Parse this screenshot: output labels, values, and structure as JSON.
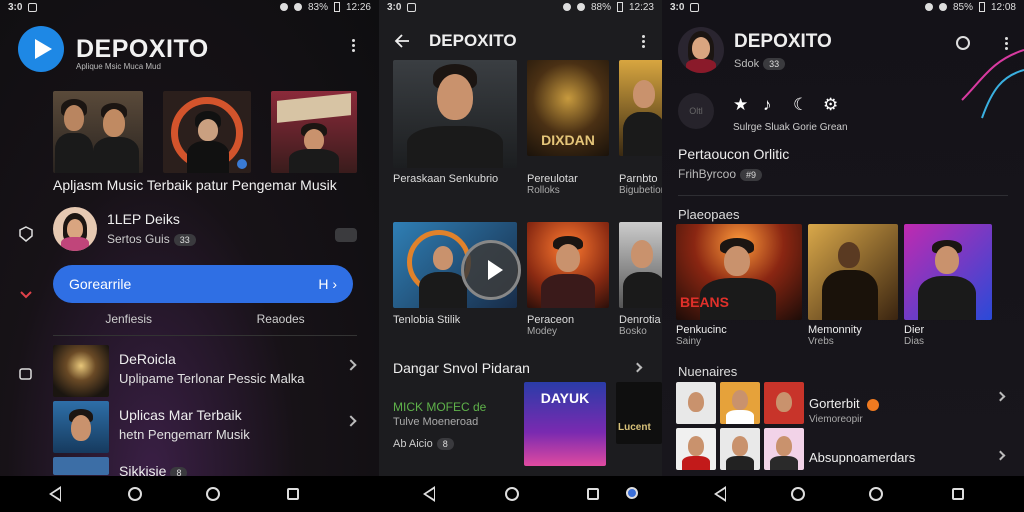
{
  "status_bars": [
    {
      "time": "3:0",
      "battery": "83%",
      "clock": "12:26"
    },
    {
      "time": "3:0",
      "battery": "88%",
      "clock": "12:23"
    },
    {
      "time": "3:0",
      "battery": "85%",
      "clock": "12:08"
    }
  ],
  "screen1": {
    "app_title": "DEPOXITO",
    "app_subtitle": "Aplique Msic Muca Mud",
    "caption": "Apljasm Music Terbaik patur Pengemar Musik",
    "profile": {
      "name": "1LEP Deiks",
      "meta": "Sertos Guis",
      "badge": "33"
    },
    "search_bar": {
      "label": "Gorearrile",
      "icon_text": "H ›"
    },
    "tabs": [
      "Jenfiesis",
      "Reaodes"
    ],
    "list": [
      {
        "title": "DeRoicla",
        "subtitle": "Uplipame Terlonar Pessic Malka"
      },
      {
        "title": "Uplicas Mar Terbaik",
        "subtitle": "hetn Pengemarr Musik"
      },
      {
        "title": "Sikkisie",
        "subtitle": "",
        "badge": "8"
      }
    ]
  },
  "screen2": {
    "title": "DEPOXITO",
    "row1": [
      {
        "label": "Peraskaan Senkubrio",
        "sub": ""
      },
      {
        "label": "Pereulotar",
        "sub": "Rolloks",
        "art_text": "DIXDAN"
      },
      {
        "label": "Parnbto",
        "sub": "Bigubetion"
      }
    ],
    "row2": [
      {
        "label": "Tenlobia Stilik",
        "sub": ""
      },
      {
        "label": "Peraceon",
        "sub": "Modey"
      },
      {
        "label": "Denrotia",
        "sub": "Bosko"
      }
    ],
    "section_title": "Dangar Snvol Pidaran",
    "section_item": {
      "line1": "MICK MOFEC de",
      "line2": "Tulve Moeneroad",
      "line3": "Ab Aicio",
      "badge": "8"
    },
    "album_art_text": "DAYUK",
    "side_art_text": "Lucent"
  },
  "screen3": {
    "title": "DEPOXITO",
    "subtitle": "Sdok",
    "sub_badge": "33",
    "icon_round_label": "Oltl",
    "icon_labels": "Sulrge Sluak Gorie Grean",
    "block_title": "Pertaoucon Orlitic",
    "block_sub": "FrihByrcoo",
    "block_badge": "#9",
    "section1": "Plaeopaes",
    "cards": [
      {
        "title": "Penkucinc",
        "sub": "Sainy",
        "art_text": "BEANS"
      },
      {
        "title": "Memonnity",
        "sub": "Vrebs"
      },
      {
        "title": "Dier",
        "sub": "Dias"
      }
    ],
    "section2": "Nuenaires",
    "list": [
      {
        "title": "Gorterbit"
      },
      {
        "title": "Absupnoamerdars"
      }
    ],
    "list_sub": "Viemoreopir"
  },
  "colors": {
    "accent": "#2f6fe4",
    "logo": "#1e88e5",
    "background": "#0e0e10"
  }
}
